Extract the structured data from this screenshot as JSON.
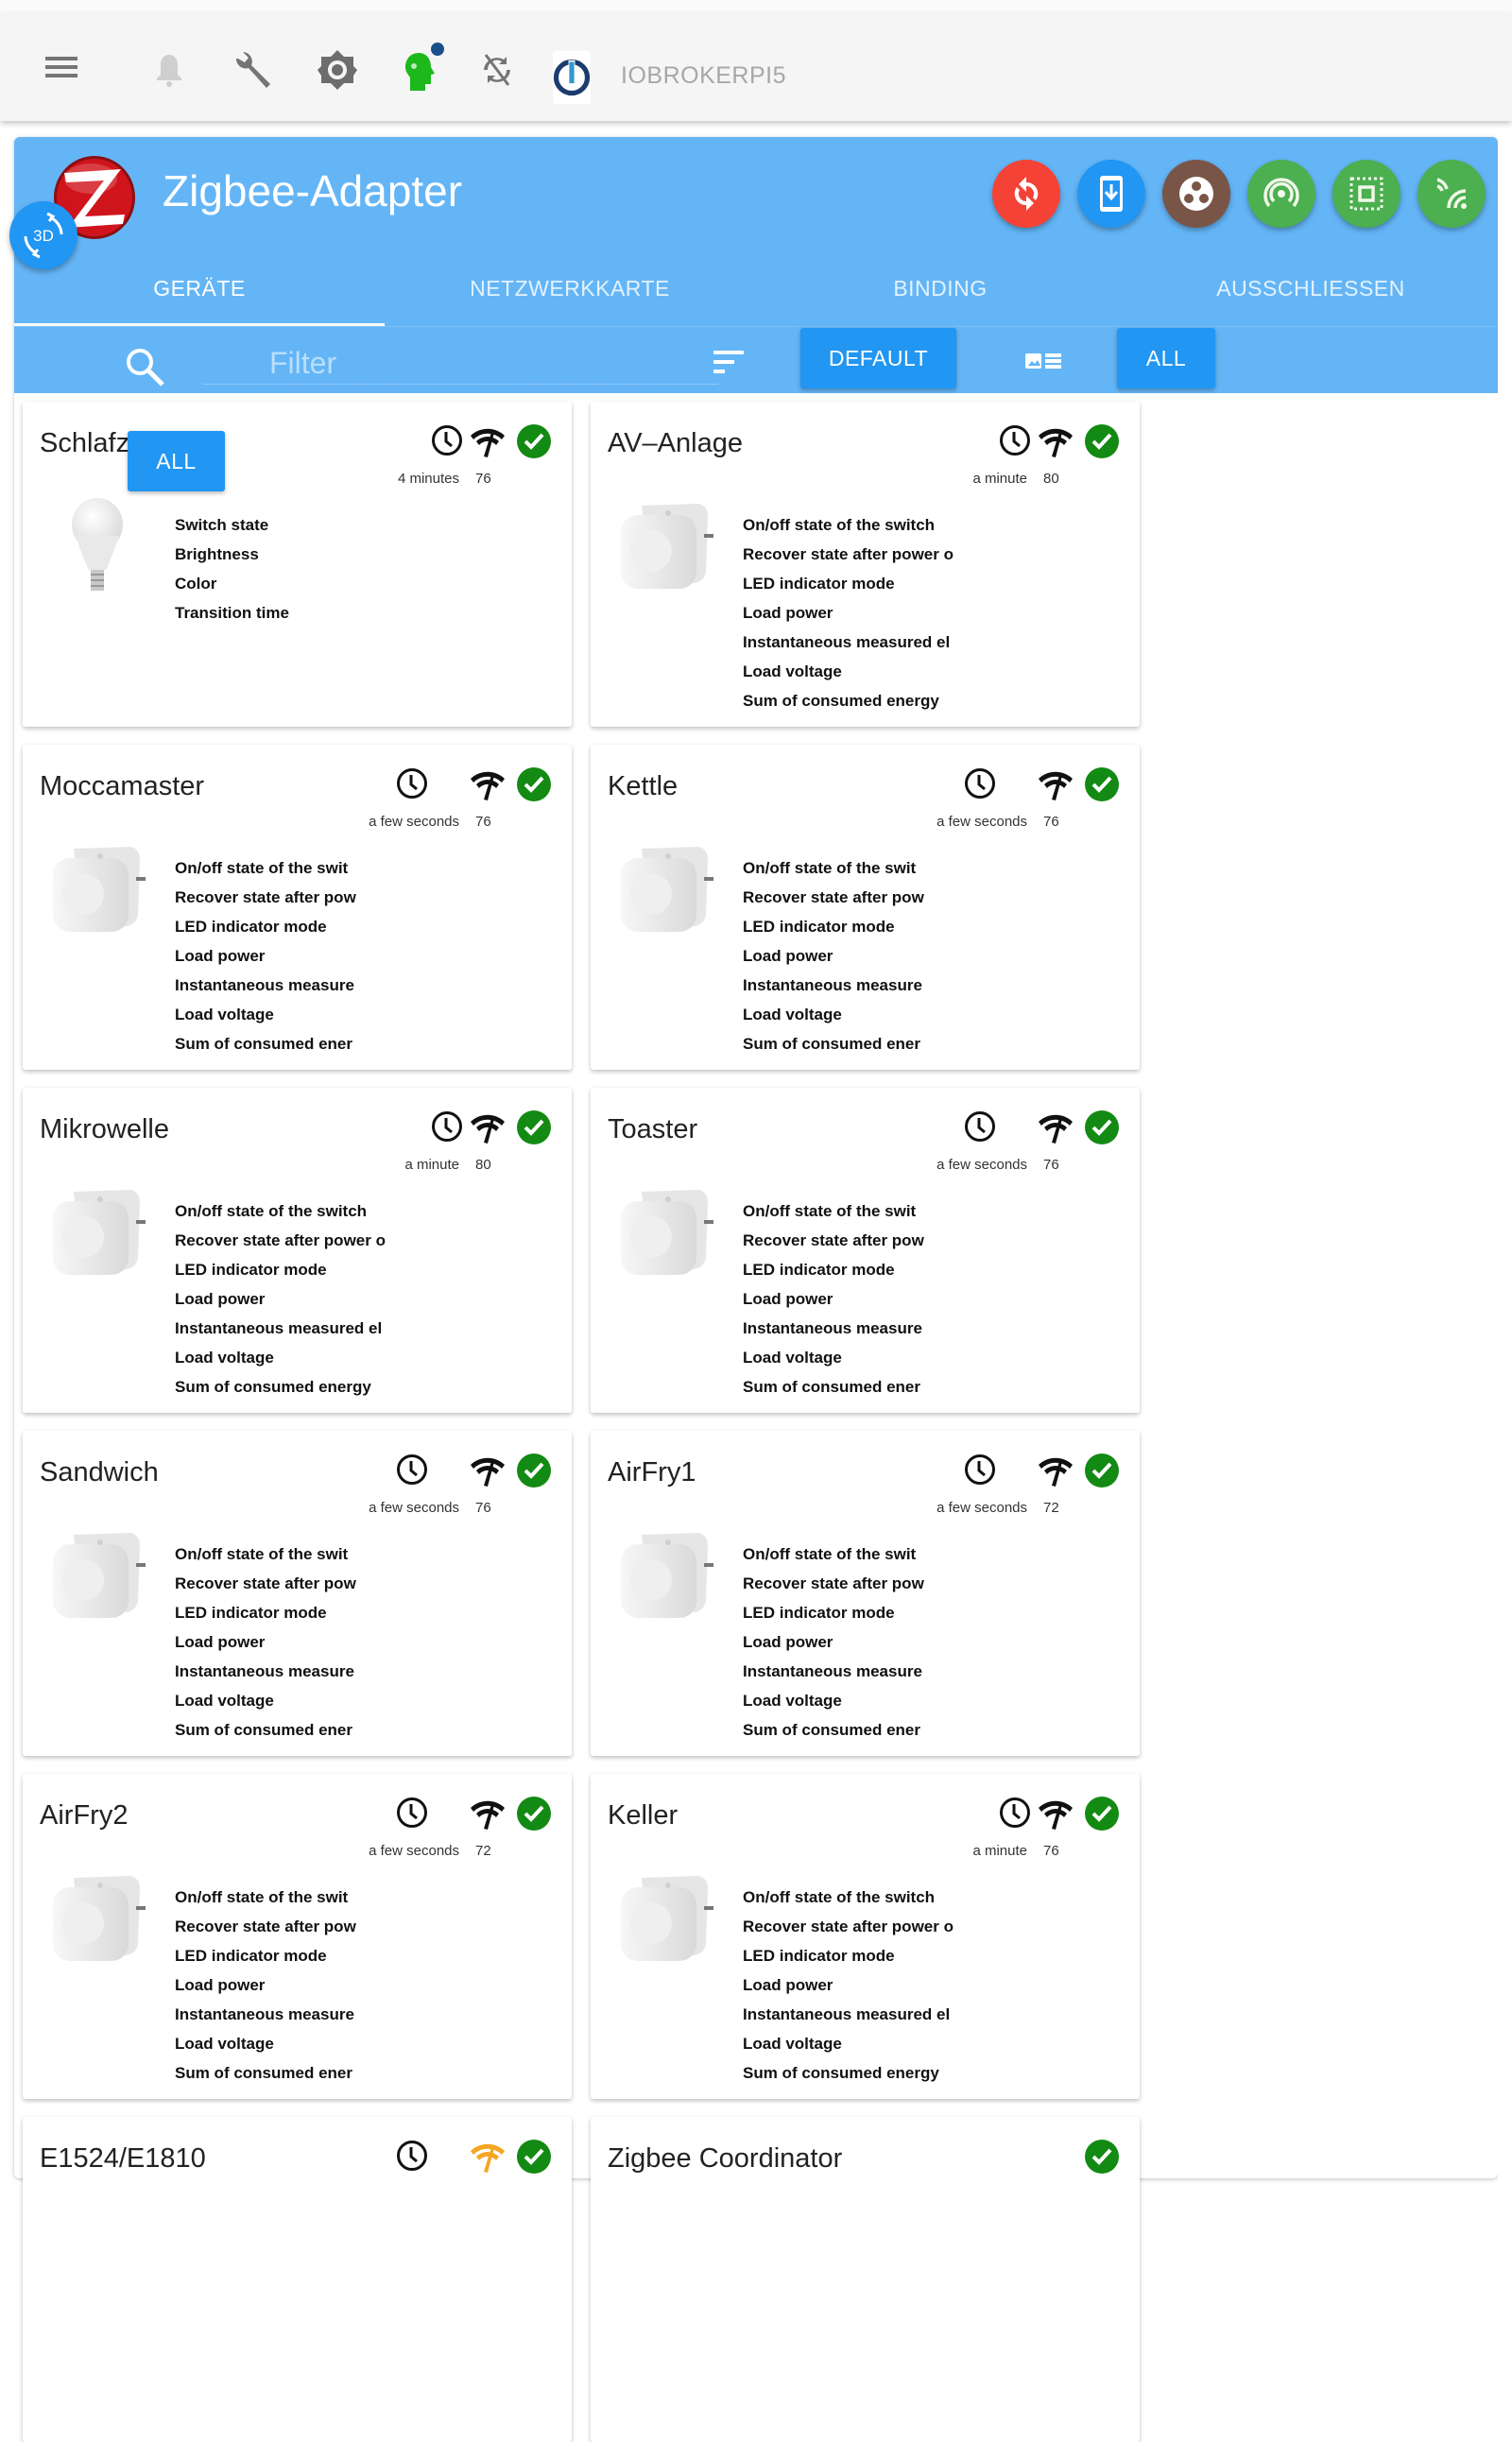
{
  "appbar": {
    "host_name": "IOBROKERPI5",
    "icons": [
      "menu-icon",
      "bell-icon",
      "wrench-icon",
      "brightness-icon",
      "expert-head-icon",
      "sync-disabled-icon",
      "iobroker-logo"
    ],
    "expert_badge_color": "#1a4f8b",
    "expert_color": "#1cb81c"
  },
  "adapter": {
    "title": "Zigbee-Adapter",
    "header_color": "#64b5f6",
    "actions": [
      {
        "name": "reset-button",
        "icon": "sync-icon",
        "color": "#f44336"
      },
      {
        "name": "backup-button",
        "icon": "phone-download-icon",
        "color": "#2196f3"
      },
      {
        "name": "groups-button",
        "icon": "groups-icon",
        "color": "#795548"
      },
      {
        "name": "pairing-button",
        "icon": "broadcast-icon",
        "color": "#4caf50"
      },
      {
        "name": "touchlink-button",
        "icon": "select-area-icon",
        "color": "#4caf50"
      },
      {
        "name": "channel-scan-button",
        "icon": "wifi-scan-icon",
        "color": "#4caf50"
      }
    ],
    "tabs": [
      {
        "label": "GERÄTE",
        "active": true
      },
      {
        "label": "NETZWERKKARTE",
        "active": false
      },
      {
        "label": "BINDING",
        "active": false
      },
      {
        "label": "AUSSCHLIESSEN",
        "active": false
      }
    ]
  },
  "filterbar": {
    "btn_3d": "3D",
    "filter_placeholder": "Filter",
    "filter_value": "",
    "default_label": "DEFAULT",
    "all_label": "ALL",
    "overlay_all_label": "ALL"
  },
  "devices": [
    {
      "name": "Schlafz",
      "type": "bulb",
      "time": "4 minutes",
      "lqi": "76",
      "signal_color": "#111111",
      "status": "ok",
      "states": [
        "Switch state",
        "Brightness",
        "Color",
        "Transition time"
      ]
    },
    {
      "name": "AV–Anlage",
      "type": "plug",
      "time": "a minute",
      "lqi": "80",
      "signal_color": "#111111",
      "status": "ok",
      "states": [
        "On/off state of the switch",
        "Recover state after power o",
        "LED indicator mode",
        "Load power",
        "Instantaneous measured el",
        "Load voltage",
        "Sum of consumed energy"
      ]
    },
    {
      "name": "Moccamaster",
      "type": "plug",
      "time": "a few seconds",
      "lqi": "76",
      "signal_color": "#111111",
      "status": "ok",
      "states": [
        "On/off state of the swit",
        "Recover state after pow",
        "LED indicator mode",
        "Load power",
        "Instantaneous measure",
        "Load voltage",
        "Sum of consumed ener"
      ]
    },
    {
      "name": "Kettle",
      "type": "plug",
      "time": "a few seconds",
      "lqi": "76",
      "signal_color": "#111111",
      "status": "ok",
      "states": [
        "On/off state of the swit",
        "Recover state after pow",
        "LED indicator mode",
        "Load power",
        "Instantaneous measure",
        "Load voltage",
        "Sum of consumed ener"
      ]
    },
    {
      "name": "Mikrowelle",
      "type": "plug",
      "time": "a minute",
      "lqi": "80",
      "signal_color": "#111111",
      "status": "ok",
      "states": [
        "On/off state of the switch",
        "Recover state after power o",
        "LED indicator mode",
        "Load power",
        "Instantaneous measured el",
        "Load voltage",
        "Sum of consumed energy"
      ]
    },
    {
      "name": "Toaster",
      "type": "plug",
      "time": "a few seconds",
      "lqi": "76",
      "signal_color": "#111111",
      "status": "ok",
      "states": [
        "On/off state of the swit",
        "Recover state after pow",
        "LED indicator mode",
        "Load power",
        "Instantaneous measure",
        "Load voltage",
        "Sum of consumed ener"
      ]
    },
    {
      "name": "Sandwich",
      "type": "plug",
      "time": "a few seconds",
      "lqi": "76",
      "signal_color": "#111111",
      "status": "ok",
      "states": [
        "On/off state of the swit",
        "Recover state after pow",
        "LED indicator mode",
        "Load power",
        "Instantaneous measure",
        "Load voltage",
        "Sum of consumed ener"
      ]
    },
    {
      "name": "AirFry1",
      "type": "plug",
      "time": "a few seconds",
      "lqi": "72",
      "signal_color": "#111111",
      "status": "ok",
      "states": [
        "On/off state of the swit",
        "Recover state after pow",
        "LED indicator mode",
        "Load power",
        "Instantaneous measure",
        "Load voltage",
        "Sum of consumed ener"
      ]
    },
    {
      "name": "AirFry2",
      "type": "plug",
      "time": "a few seconds",
      "lqi": "72",
      "signal_color": "#111111",
      "status": "ok",
      "states": [
        "On/off state of the swit",
        "Recover state after pow",
        "LED indicator mode",
        "Load power",
        "Instantaneous measure",
        "Load voltage",
        "Sum of consumed ener"
      ]
    },
    {
      "name": "Keller",
      "type": "plug",
      "time": "a minute",
      "lqi": "76",
      "signal_color": "#111111",
      "status": "ok",
      "states": [
        "On/off state of the switch",
        "Recover state after power o",
        "LED indicator mode",
        "Load power",
        "Instantaneous measured el",
        "Load voltage",
        "Sum of consumed energy"
      ]
    },
    {
      "name": "E1524/E1810",
      "type": "remote",
      "time": "",
      "lqi": "",
      "signal_color": "#f5a623",
      "status": "ok",
      "states": []
    },
    {
      "name": "Zigbee Coordinator",
      "type": "coordinator",
      "time": "",
      "lqi": "",
      "signal_color": "",
      "status": "ok",
      "states": []
    }
  ],
  "colors": {
    "ok_green": "#138a13",
    "primary_blue": "#2196f3"
  }
}
